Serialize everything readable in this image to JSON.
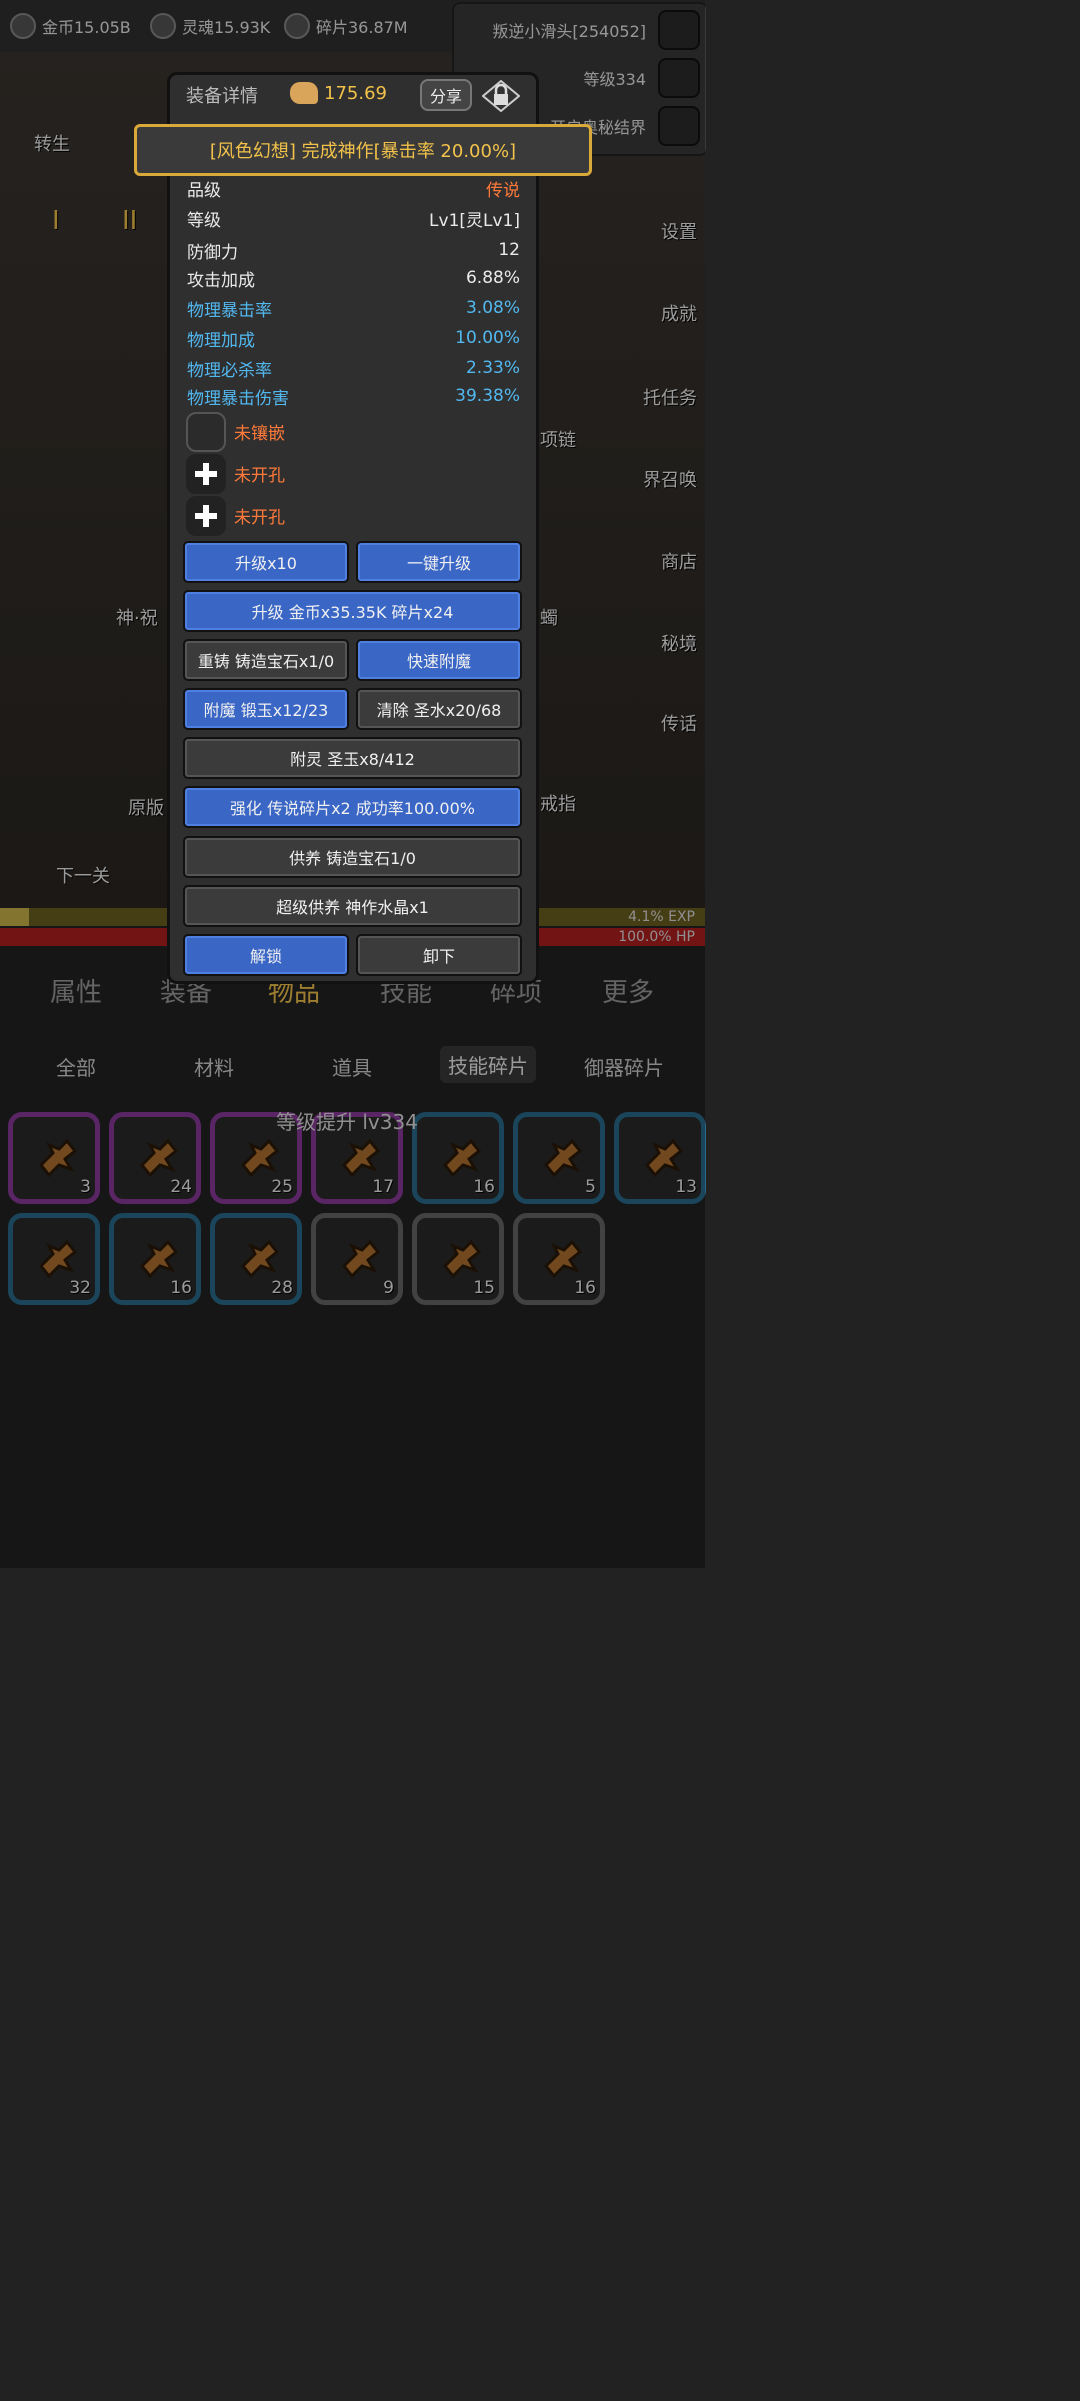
{
  "topbar": {
    "gold": "金币15.05B",
    "soul": "灵魂15.93K",
    "shard": "碎片36.87M"
  },
  "player": {
    "name": "叛逆小滑头[254052]",
    "level": "等级334",
    "secret": "开启奥秘结界"
  },
  "side_buttons": {
    "settings": "设置",
    "achievement": "成就",
    "task": "托任务",
    "summon": "界召唤",
    "shop": "商店",
    "secret_realm": "秘境",
    "legend": "传话"
  },
  "left_scene": {
    "rebirth": "转生",
    "tier1": "I",
    "tier2": "II",
    "item_name": "神·祝",
    "original": "原版",
    "next_level": "下一关",
    "chain": "项链",
    "ring": "戒指",
    "candle": "蠋"
  },
  "dialog": {
    "title": "装备详情",
    "power": "175.69",
    "share": "分享",
    "banner": "[风色幻想] 完成神作[暴击率 20.00%]",
    "stats": [
      {
        "k": "品级",
        "v": "传说",
        "style": "orange"
      },
      {
        "k": "等级",
        "v": "Lv1[灵Lv1]",
        "style": ""
      },
      {
        "k": "防御力",
        "v": "12",
        "style": ""
      },
      {
        "k": "攻击加成",
        "v": "6.88%",
        "style": ""
      },
      {
        "k": "物理暴击率",
        "v": "3.08%",
        "style": "blue"
      },
      {
        "k": "物理加成",
        "v": "10.00%",
        "style": "blue"
      },
      {
        "k": "物理必杀率",
        "v": "2.33%",
        "style": "blue"
      },
      {
        "k": "物理暴击伤害",
        "v": "39.38%",
        "style": "blue"
      }
    ],
    "sockets": [
      "未镶嵌",
      "未开孔",
      "未开孔"
    ],
    "buttons": {
      "upgrade10": "升级x10",
      "one_click": "一键升级",
      "upgrade_cost": "升级 金币x35.35K 碎片x24",
      "recast": "重铸 铸造宝石x1/0",
      "quick_enchant": "快速附魔",
      "enchant": "附魔 锻玉x12/23",
      "clear": "清除 圣水x20/68",
      "spirit": "附灵 圣玉x8/412",
      "strengthen": "强化 传说碎片x2 成功率100.00%",
      "feed": "供养 铸造宝石1/0",
      "super_feed": "超级供养 神作水晶x1",
      "unlock": "解锁",
      "unequip": "卸下"
    }
  },
  "bars": {
    "exp": "4.1% EXP",
    "exp_fraction": 0.041,
    "hp": "100.0% HP"
  },
  "nav": {
    "tabs": [
      "属性",
      "装备",
      "物品",
      "技能",
      "碎项",
      "更多"
    ],
    "subtabs": [
      "全部",
      "材料",
      "道具",
      "技能碎片",
      "御器碎片"
    ]
  },
  "inventory": {
    "levelup": "等级提升 lv334",
    "items": [
      {
        "count": "3",
        "rarity": "purple"
      },
      {
        "count": "24",
        "rarity": "purple"
      },
      {
        "count": "25",
        "rarity": "purple"
      },
      {
        "count": "17",
        "rarity": "purple"
      },
      {
        "count": "16",
        "rarity": "blue"
      },
      {
        "count": "5",
        "rarity": "blue"
      },
      {
        "count": "13",
        "rarity": "blue"
      },
      {
        "count": "32",
        "rarity": "blue"
      },
      {
        "count": "16",
        "rarity": "blue"
      },
      {
        "count": "28",
        "rarity": "blue"
      },
      {
        "count": "9",
        "rarity": "gray"
      },
      {
        "count": "15",
        "rarity": "gray"
      },
      {
        "count": "16",
        "rarity": "gray"
      }
    ]
  }
}
